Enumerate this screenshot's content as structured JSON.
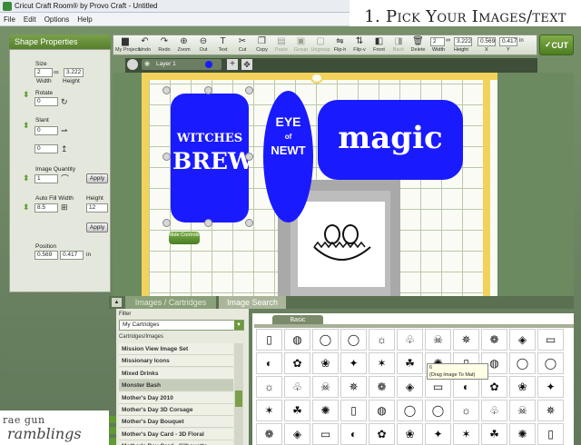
{
  "window": {
    "title": "Cricut Craft Room® by Provo Craft - Untitled"
  },
  "menu": [
    "File",
    "Edit",
    "Options",
    "Help"
  ],
  "overlay_caption": "1. Pick Your Images/text",
  "shape_properties": {
    "header": "Shape Properties",
    "size_label": "Size",
    "width_value": "2",
    "height_value": "3.222",
    "width_label": "Width",
    "height_label": "Height",
    "rotate_label": "Rotate",
    "rotate_value": "0",
    "slant_label": "Slant",
    "slant_x": "0",
    "slant_y": "0",
    "quantity_label": "Image Quantity",
    "quantity_value": "1",
    "apply1": "Apply",
    "autofill_label": "Auto Fill Width",
    "autofill_height_label": "Height",
    "autofill_width_value": "8.5",
    "autofill_height_value": "12",
    "apply2": "Apply",
    "position_label": "Position",
    "pos_x": "0.569",
    "pos_y": "0.417",
    "pos_unit": "in"
  },
  "toolbar": {
    "tools": [
      {
        "label": "My Projects",
        "icon": "folder-icon",
        "glyph": "▆",
        "dim": false
      },
      {
        "label": "Undo",
        "icon": "undo-icon",
        "glyph": "↶",
        "dim": false
      },
      {
        "label": "Redo",
        "icon": "redo-icon",
        "glyph": "↷",
        "dim": false
      },
      {
        "label": "Zoom",
        "icon": "zoom-in-icon",
        "glyph": "⊕",
        "dim": false
      },
      {
        "label": "Out",
        "icon": "zoom-out-icon",
        "glyph": "⊖",
        "dim": false
      },
      {
        "label": "Text",
        "icon": "text-icon",
        "glyph": "T",
        "dim": false
      },
      {
        "label": "Cut",
        "icon": "scissors-icon",
        "glyph": "✂",
        "dim": false
      },
      {
        "label": "Copy",
        "icon": "copy-icon",
        "glyph": "❐",
        "dim": false
      },
      {
        "label": "Paste",
        "icon": "paste-icon",
        "glyph": "▤",
        "dim": true
      },
      {
        "label": "Group",
        "icon": "group-icon",
        "glyph": "▣",
        "dim": true
      },
      {
        "label": "Ungroup",
        "icon": "ungroup-icon",
        "glyph": "▢",
        "dim": true
      },
      {
        "label": "Flip-h",
        "icon": "flip-h-icon",
        "glyph": "⇋",
        "dim": false
      },
      {
        "label": "Flip-v",
        "icon": "flip-v-icon",
        "glyph": "⇅",
        "dim": false
      },
      {
        "label": "Front",
        "icon": "front-icon",
        "glyph": "◧",
        "dim": false
      },
      {
        "label": "Back",
        "icon": "back-icon",
        "glyph": "◨",
        "dim": true
      },
      {
        "label": "Delete",
        "icon": "trash-icon",
        "glyph": "🗑",
        "dim": false
      }
    ],
    "w": "2",
    "h": "3.222",
    "x": "0.569",
    "y": "0.417",
    "unit": "in",
    "w_label": "Width",
    "h_label": "Height",
    "x_label": "X",
    "y_label": "Y",
    "cut_label": "CUT"
  },
  "layer": {
    "name": "Layer 1",
    "color": "#1a1aff"
  },
  "canvas": {
    "shape1_lines": [
      "WITCHES",
      "BREW"
    ],
    "shape2_lines": [
      "EYE",
      "of",
      "NEWT"
    ],
    "shape3_text": "magic",
    "hide_button": "Hide Controls",
    "blue": "#1a1aff"
  },
  "bottom": {
    "tab_images": "Images / Cartridges",
    "tab_search": "Image Search",
    "filter_label": "Filter",
    "filter_value": "My Cartridges",
    "cart_label": "Cartridges/Images",
    "cartridges": [
      "Mission View Image Set",
      "Missionary Icons",
      "Mixed Drinks",
      "Monster Bash",
      "Mother's Day 2010",
      "Mother's Day 3D Corsage",
      "Mother's Day Bouquet",
      "Mother's Day Card - 3D Floral",
      "Mother's Day Card - Silhouette"
    ],
    "selected_index": 3,
    "basic_tab": "Basic",
    "tooltip_num": "6",
    "tooltip": "(Drag Image To Mat)"
  },
  "watermark": {
    "line1": "rae gun",
    "line2": "ramblings"
  }
}
